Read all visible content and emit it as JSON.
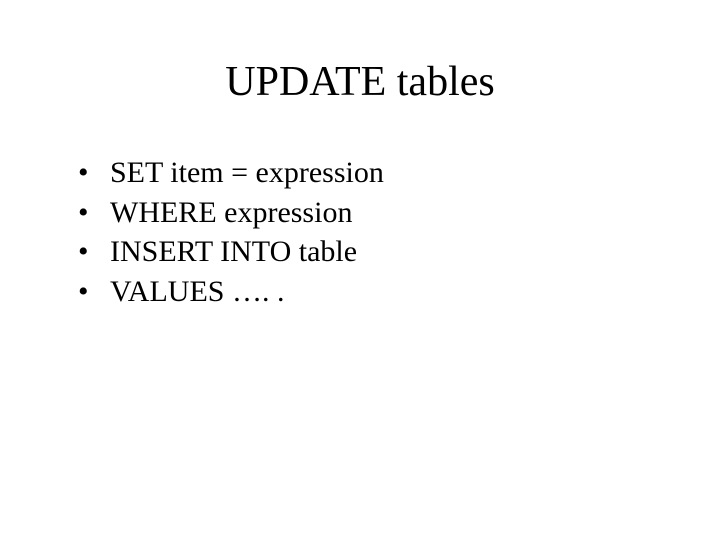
{
  "slide": {
    "title": "UPDATE tables",
    "bullets": [
      "SET item = expression",
      "WHERE expression",
      "INSERT INTO table",
      "VALUES …. ."
    ]
  }
}
